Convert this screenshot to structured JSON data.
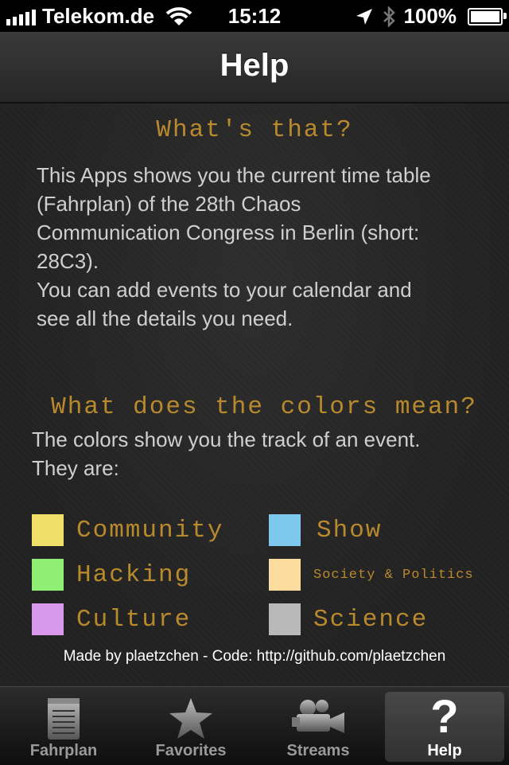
{
  "status_bar": {
    "carrier": "Telekom.de",
    "time": "15:12",
    "battery": "100%",
    "battery_level": 1.0
  },
  "nav": {
    "title": "Help"
  },
  "whats_that": {
    "heading": "What's that?",
    "body_lines": [
      "This Apps shows you the current time table",
      "(Fahrplan) of the 28th Chaos",
      "Communication Congress in Berlin (short:",
      "28C3).",
      "You can add events to your calendar and",
      "see all the details you need."
    ]
  },
  "colors": {
    "heading": "What does the colors mean?",
    "body_lines": [
      "The colors show you the track of an event.",
      "They are:"
    ],
    "tracks": [
      {
        "label": "Community",
        "color": "#f0e06a"
      },
      {
        "label": "Show",
        "color": "#7ec8ee"
      },
      {
        "label": "Hacking",
        "color": "#8fef75"
      },
      {
        "label": "Society & Politics",
        "color": "#fbdc9e"
      },
      {
        "label": "Culture",
        "color": "#d898ec"
      },
      {
        "label": "Science",
        "color": "#b9b9b9"
      }
    ]
  },
  "footer": "Made by plaetzchen - Code: http://github.com/plaetzchen",
  "tabs": [
    {
      "label": "Fahrplan",
      "icon": "notepad-icon",
      "selected": false
    },
    {
      "label": "Favorites",
      "icon": "star-icon",
      "selected": false
    },
    {
      "label": "Streams",
      "icon": "video-camera-icon",
      "selected": false
    },
    {
      "label": "Help",
      "icon": "question-mark-icon",
      "selected": true
    }
  ]
}
